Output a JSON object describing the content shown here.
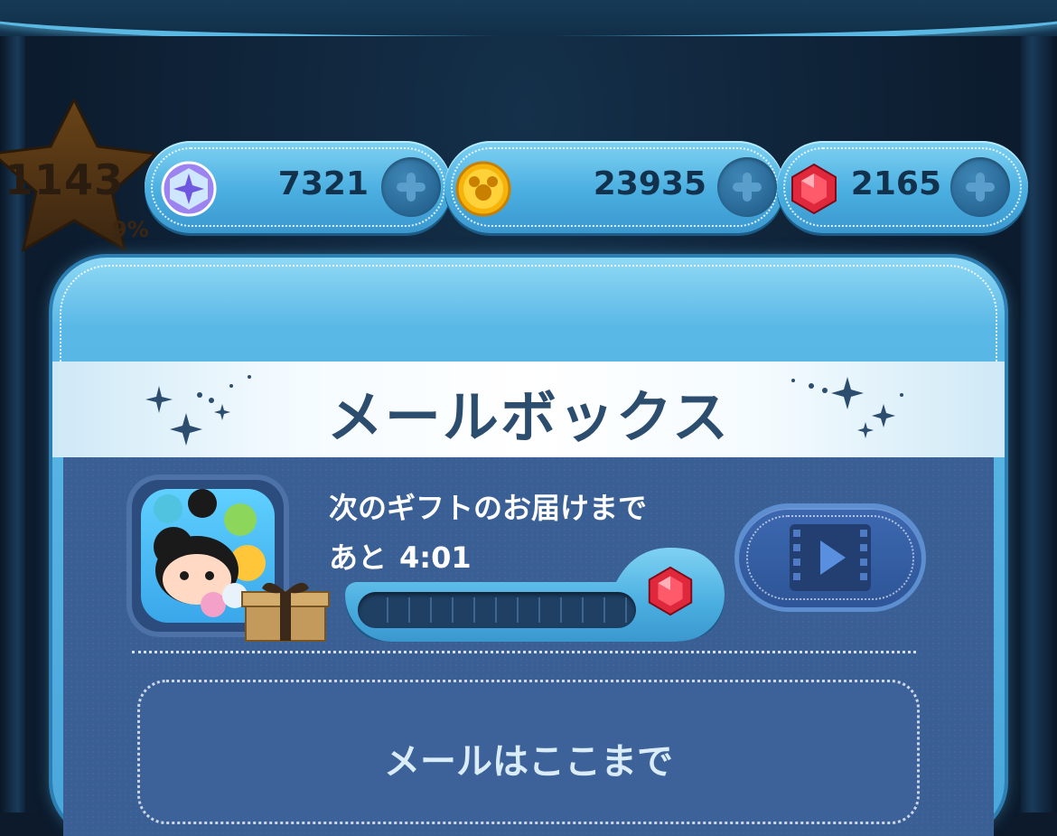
{
  "player": {
    "level": "1143",
    "level_progress": "9%"
  },
  "currencies": {
    "star_tickets": {
      "icon": "star-medal-icon",
      "value": "7321"
    },
    "coins": {
      "icon": "coin-icon",
      "value": "23935"
    },
    "rubies": {
      "icon": "ruby-icon",
      "value": "2165"
    }
  },
  "mailbox": {
    "title": "メールボックス",
    "next_gift_label": "次のギフトのお届けまで",
    "remaining_prefix": "あと",
    "remaining_time": "4:01",
    "gift_progress": 0.0,
    "video_button_icon": "film-play-icon",
    "end_message": "メールはここまで"
  },
  "colors": {
    "accent_light_blue": "#5ab8e3",
    "panel_blue": "#3a5f95",
    "title_text": "#2d4d6e",
    "ruby_red": "#e0283c",
    "coin_gold": "#f6b30a"
  }
}
